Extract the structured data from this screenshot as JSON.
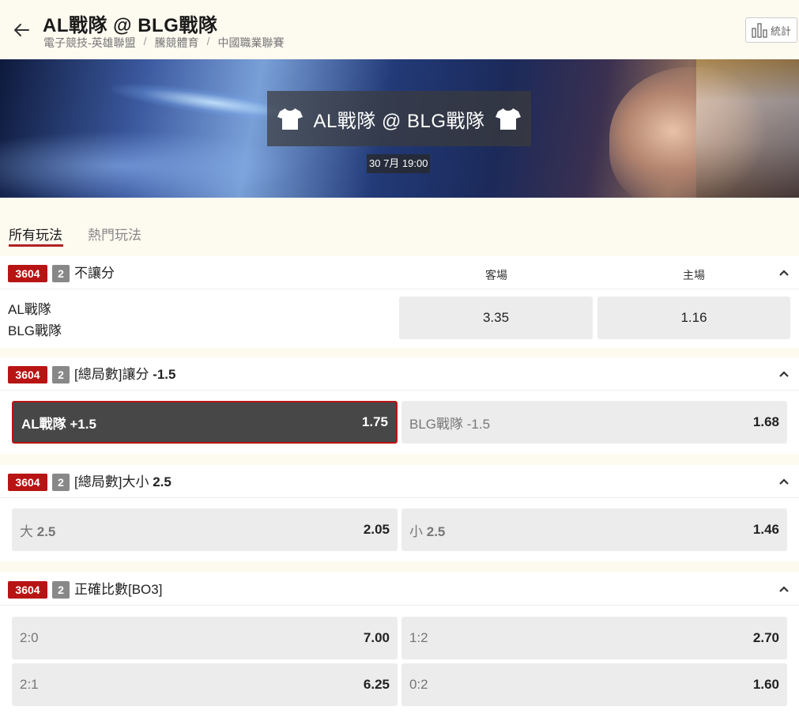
{
  "header": {
    "title": "AL戰隊 @ BLG戰隊",
    "breadcrumbs": [
      "電子競技-英雄聯盟",
      "騰競體育",
      "中國職業聯賽"
    ],
    "stats_label": "統計"
  },
  "banner": {
    "match_title": "AL戰隊 @ BLG戰隊",
    "date": "30 7月 19:00"
  },
  "tabs": [
    {
      "label": "所有玩法",
      "active": true
    },
    {
      "label": "熱門玩法",
      "active": false
    }
  ],
  "markets": [
    {
      "id": "3604",
      "count": "2",
      "name": "不讓分",
      "columns": [
        "客場",
        "主場"
      ],
      "teams": [
        "AL戰隊",
        "BLG戰隊"
      ],
      "odds": [
        "3.35",
        "1.16"
      ]
    },
    {
      "id": "3604",
      "count": "2",
      "name_prefix": "[總局數]讓分",
      "name_value": "-1.5",
      "selections": [
        {
          "label": "AL戰隊 +1.5",
          "odds": "1.75",
          "selected": true
        },
        {
          "label": "BLG戰隊 -1.5",
          "odds": "1.68",
          "selected": false
        }
      ]
    },
    {
      "id": "3604",
      "count": "2",
      "name_prefix": "[總局數]大小",
      "name_value": "2.5",
      "selections": [
        {
          "label_prefix": "大",
          "label_value": "2.5",
          "odds": "2.05"
        },
        {
          "label_prefix": "小",
          "label_value": "2.5",
          "odds": "1.46"
        }
      ]
    },
    {
      "id": "3604",
      "count": "2",
      "name": "正確比數[BO3]",
      "selections": [
        {
          "label": "2:0",
          "odds": "7.00"
        },
        {
          "label": "1:2",
          "odds": "2.70"
        },
        {
          "label": "2:1",
          "odds": "6.25"
        },
        {
          "label": "0:2",
          "odds": "1.60"
        }
      ]
    }
  ],
  "colors": {
    "accent": "#b81414",
    "background": "#fdfaf0",
    "cell": "#ececec",
    "selected_cell": "#474747"
  },
  "icons": [
    "back-arrow-icon",
    "bar-chart-icon",
    "shirt-icon",
    "chevron-up-icon"
  ]
}
